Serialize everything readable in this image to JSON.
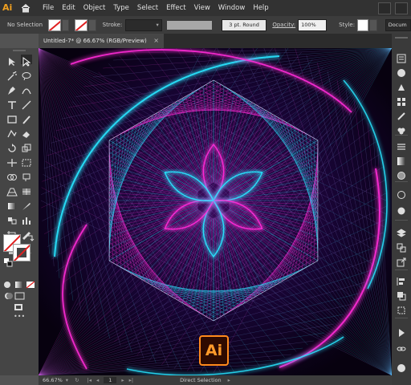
{
  "app": {
    "logo": "Ai"
  },
  "menu": [
    "File",
    "Edit",
    "Object",
    "Type",
    "Select",
    "Effect",
    "View",
    "Window",
    "Help"
  ],
  "control": {
    "selection": "No Selection",
    "stroke_label": "Stroke:",
    "stroke_value": "",
    "brush": "3 pt. Round",
    "opacity_label": "Opacity:",
    "opacity_value": "100%",
    "style_label": "Style:",
    "doc_label": "Docum"
  },
  "tab": {
    "title": "Untitled-7* @ 66.67% (RGB/Preview)",
    "close": "×"
  },
  "status": {
    "zoom": "66.67%",
    "page": "1",
    "tool": "Direct Selection"
  },
  "badge": {
    "text": "Ai"
  },
  "colors": {
    "magenta": "#ff2bd6",
    "cyan": "#28e6ff",
    "accent": "#ff8a1c"
  }
}
